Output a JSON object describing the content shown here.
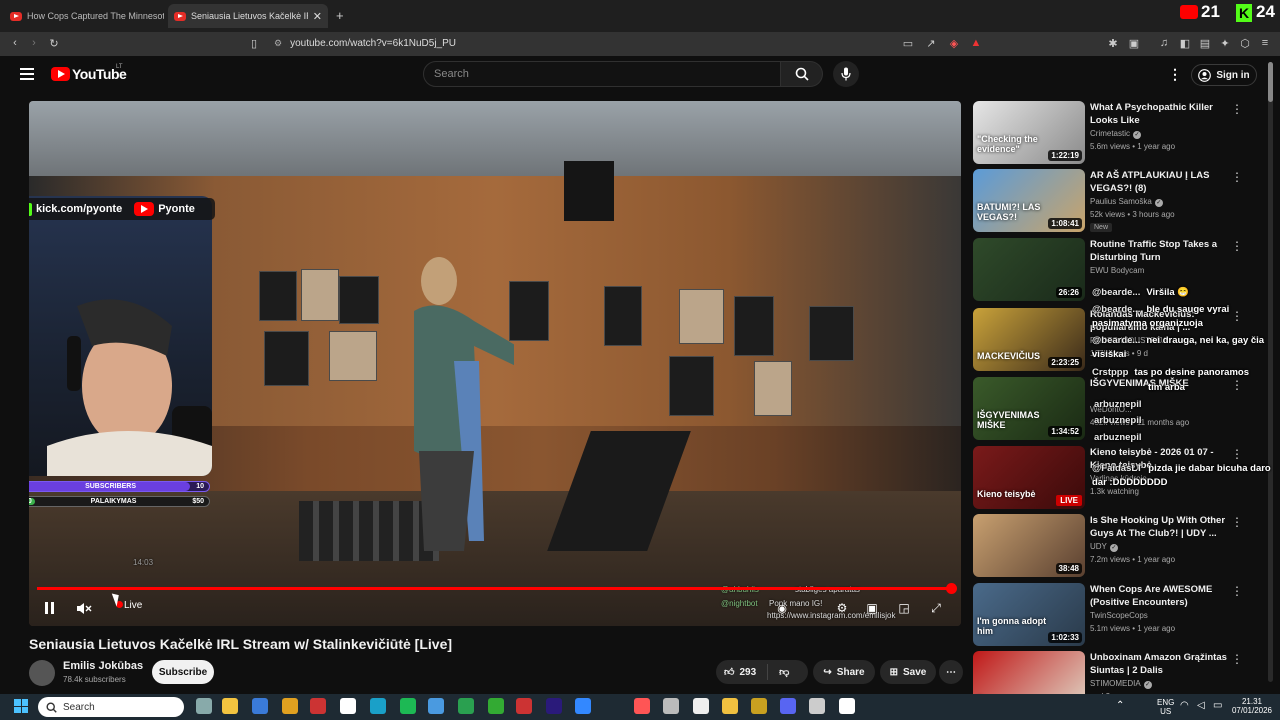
{
  "browser": {
    "tabs": [
      {
        "title": "How Cops Captured The Minnesota M",
        "active": false
      },
      {
        "title": "Seniausia Lietuvos Kačelkė IRL St",
        "active": true
      }
    ],
    "new_tab": "+",
    "url": "youtube.com/watch?v=6k1NuD5j_PU",
    "news_badge": "21",
    "news_badge2": "24"
  },
  "youtube": {
    "logo": "YouTube",
    "country": "LT",
    "search_placeholder": "Search",
    "sign_in": "Sign in"
  },
  "video": {
    "overlay": {
      "kick_handle": "kick.com/pyonte",
      "yt_handle": "Pyonte",
      "goal1_label": "SUBSCRIBERS",
      "goal1_left": "9",
      "goal1_right": "10",
      "goal1_progress": 0.9,
      "goal2_label": "PALAIKYMAS",
      "goal2_left": "$0",
      "goal2_right": "$50",
      "goal2_progress": 0.0,
      "stream_time": "14:03",
      "bottom_lines": [
        "stabliges aparatas",
        "Ponk mano IG!",
        "https://www.instagram.com/emilisjok"
      ],
      "bottom_users": [
        "@ahbuhiis",
        "@nightbot"
      ]
    },
    "progress": 0.997,
    "live_label": "Live",
    "title": "Seniausia Lietuvos Kačelkė IRL Stream w/ Stalinkevičiūtė [Live]",
    "channel": "Emilis Jokūbas",
    "subscribers": "78.4k subscribers",
    "subscribe": "Subscribe",
    "likes": "293",
    "share": "Share",
    "save": "Save"
  },
  "recommendations": [
    {
      "title": "What A Psychopathic Killer Looks Like",
      "channel": "Crimetastic",
      "verified": true,
      "meta": "5.6m views • 1 year ago",
      "duration": "1:22:19",
      "thumb_text": "\"Checking the evidence\"",
      "colors": [
        "#e6e6e6",
        "#8a8a8a"
      ]
    },
    {
      "title": "AR AŠ ATPLAUKIAU Į LAS VEGAS?! (8)",
      "channel": "Paulius Samoška",
      "verified": true,
      "meta": "52k views • 3 hours ago",
      "duration": "1:08:41",
      "badge": "New",
      "thumb_text": "BATUMI?! LAS VEGAS?!",
      "colors": [
        "#5b9bd8",
        "#c9a46a"
      ]
    },
    {
      "title": "Routine Traffic Stop Takes a Disturbing Turn",
      "channel": "EWU Bodycam",
      "verified": false,
      "meta": "",
      "duration": "26:26",
      "thumb_text": "",
      "colors": [
        "#2f4a2a",
        "#1a2a1a"
      ]
    },
    {
      "title": "Rolandas Mackevičius: populiarumo kaina | ...",
      "channel": "PROTO INDUSTRIJA",
      "verified": false,
      "meta": "167k views • 9 d",
      "duration": "2:23:25",
      "thumb_text": "MACKEVIČIUS",
      "colors": [
        "#c9a23a",
        "#3a2a1a"
      ]
    },
    {
      "title": "IŠGYVENIMAS MIŠKE",
      "channel": "WeDontO...",
      "verified": false,
      "meta": "452k views • 11 months ago",
      "duration": "1:34:52",
      "thumb_text": "IŠGYVENIMAS MIŠKE",
      "colors": [
        "#3a5a2a",
        "#1a2a14"
      ]
    },
    {
      "title": "Kieno teisybė - 2026 01 07 - Kieno teisybė",
      "channel": "Varlinas kūdroje",
      "verified": false,
      "meta": "1.3k watching",
      "duration": "",
      "live": "LIVE",
      "thumb_text": "Kieno teisybė",
      "colors": [
        "#7a1a1a",
        "#3a0a0a"
      ]
    },
    {
      "title": "Is She Hooking Up With Other Guys At The Club?! | UDY ...",
      "channel": "UDY",
      "verified": true,
      "meta": "7.2m views • 1 year ago",
      "duration": "38:48",
      "thumb_text": "",
      "colors": [
        "#c8a070",
        "#5a4030"
      ]
    },
    {
      "title": "When Cops Are AWESOME (Positive Encounters)",
      "channel": "TwinScopeCops",
      "verified": false,
      "meta": "5.1m views • 1 year ago",
      "duration": "1:02:33",
      "thumb_text": "I'm gonna adopt him",
      "colors": [
        "#4a6a8a",
        "#2a3a4a"
      ]
    },
    {
      "title": "Unboxinam Amazon Grąžintas Siuntas | 2 Dalis",
      "channel": "STIMOMEDIA",
      "verified": true,
      "meta": "and 2 more",
      "duration": "",
      "thumb_text": "?",
      "colors": [
        "#c01818",
        "#e0d8c8"
      ]
    }
  ],
  "chat": [
    {
      "user": "@bearde...",
      "text": "Viršila 😁"
    },
    {
      "user": "@bearde...",
      "text": "ble du sauge vyrai pasimatyma organizuoja"
    },
    {
      "user": "@bearde...",
      "text": "nei drauga, nei ka, gay čia visiškai"
    },
    {
      "user": "Crstppp",
      "text": "tas po desine panoramos"
    },
    {
      "user": "",
      "text": "tim arba"
    },
    {
      "user": "arbuznepil",
      "text": ""
    },
    {
      "user": "arbuznepil",
      "text": ""
    },
    {
      "user": "arbuznepil",
      "text": ""
    },
    {
      "user": "@FaidasLT",
      "text": "pizda jie dabar bicuha daro dar :DDDDDDDD"
    }
  ],
  "taskbar": {
    "search": "Search",
    "lang": "ENG",
    "region": "US",
    "time": "21.31",
    "date": "07/01/2026"
  }
}
